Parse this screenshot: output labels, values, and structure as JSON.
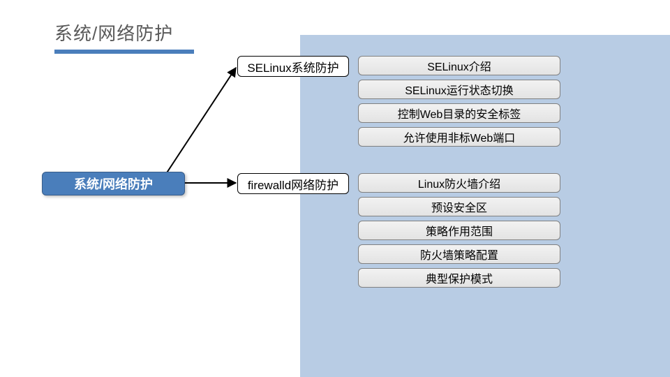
{
  "title": "系统/网络防护",
  "colors": {
    "accent": "#4a7ebb",
    "panel": "#b8cce4",
    "title_text": "#595959"
  },
  "root": {
    "label": "系统/网络防护"
  },
  "branches": [
    {
      "label": "SELinux系统防护",
      "leaves": [
        "SELinux介绍",
        "SELinux运行状态切换",
        "控制Web目录的安全标签",
        "允许使用非标Web端口"
      ]
    },
    {
      "label": "firewalld网络防护",
      "leaves": [
        "Linux防火墙介绍",
        "预设安全区",
        "策略作用范围",
        "防火墙策略配置",
        "典型保护模式"
      ]
    }
  ]
}
